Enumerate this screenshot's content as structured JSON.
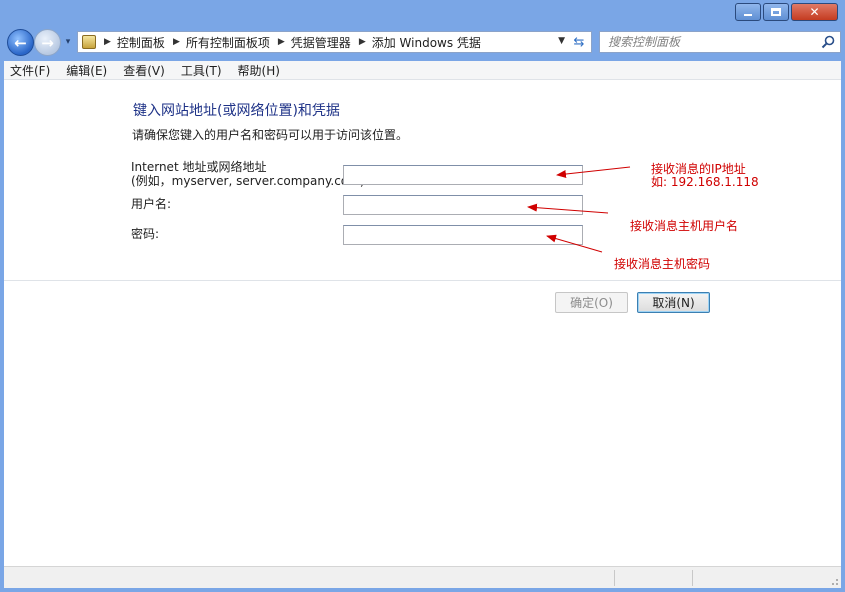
{
  "window": {
    "minimize_icon": "minimize-icon",
    "maximize_icon": "maximize-icon",
    "close_label": "✕"
  },
  "navigation": {
    "back_icon": "back-arrow-icon",
    "forward_icon": "forward-arrow-icon",
    "history_icon": "chevron-down-icon"
  },
  "address_bar": {
    "breadcrumbs": [
      "控制面板",
      "所有控制面板项",
      "凭据管理器",
      "添加 Windows 凭据"
    ],
    "dropdown_icon": "chevron-down-icon",
    "refresh_icon": "refresh-icon"
  },
  "search": {
    "placeholder": "搜索控制面板",
    "icon": "search-icon"
  },
  "menu": {
    "items": [
      "文件(F)",
      "编辑(E)",
      "查看(V)",
      "工具(T)",
      "帮助(H)"
    ]
  },
  "form": {
    "heading": "键入网站地址(或网络位置)和凭据",
    "subtext": "请确保您键入的用户名和密码可以用于访问该位置。",
    "address_label_line1": "Internet 地址或网络地址",
    "address_label_line2": "(例如，myserver, server.company.com):",
    "address_value": "",
    "username_label": "用户名:",
    "username_value": "",
    "password_label": "密码:",
    "password_value": ""
  },
  "buttons": {
    "ok_label": "确定(O)",
    "cancel_label": "取消(N)"
  },
  "annotations": {
    "ip_line1": "接收消息的IP地址",
    "ip_line2": "如: 192.168.1.118",
    "username_note": "接收消息主机用户名",
    "password_note": "接收消息主机密码",
    "color": "#d00000"
  }
}
